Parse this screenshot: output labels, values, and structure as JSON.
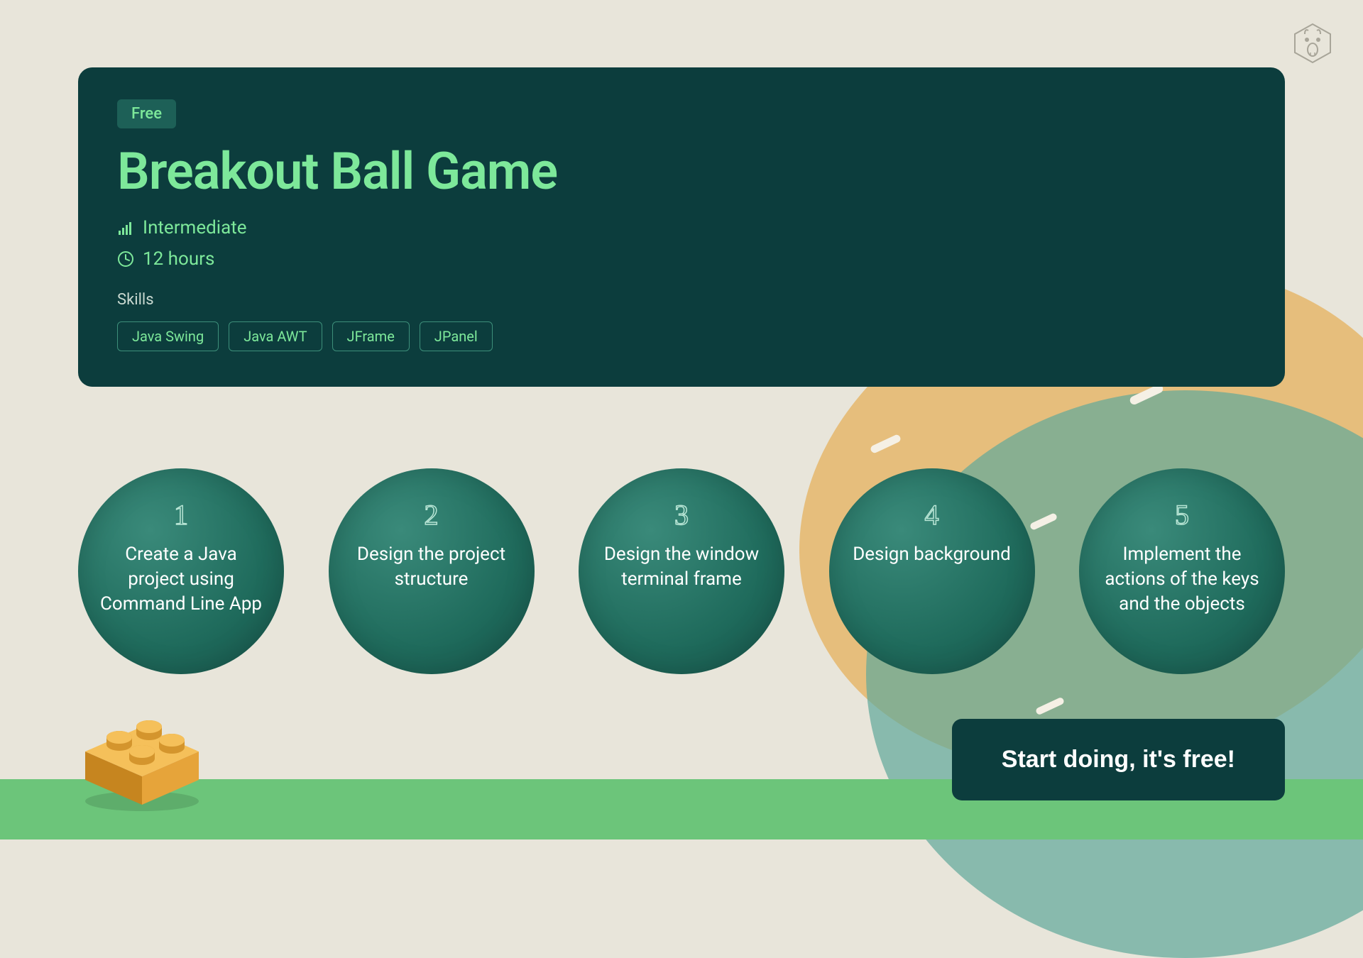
{
  "hero": {
    "badge": "Free",
    "title": "Breakout Ball Game",
    "level": "Intermediate",
    "duration": "12 hours",
    "skills_label": "Skills",
    "skills": [
      "Java Swing",
      "Java AWT",
      "JFrame",
      "JPanel"
    ]
  },
  "steps": [
    {
      "num": "1",
      "text": "Create a Java project using Command Line App"
    },
    {
      "num": "2",
      "text": "Design the project structure"
    },
    {
      "num": "3",
      "text": "Design the window terminal frame"
    },
    {
      "num": "4",
      "text": "Design background"
    },
    {
      "num": "5",
      "text": "Implement the actions of the keys and the objects"
    }
  ],
  "cta": {
    "label": "Start doing, it's free!"
  },
  "colors": {
    "hero_bg": "#0c3d3d",
    "accent_green": "#7de89a",
    "page_bg": "#e8e5da",
    "strip_green": "#6cc57a"
  }
}
